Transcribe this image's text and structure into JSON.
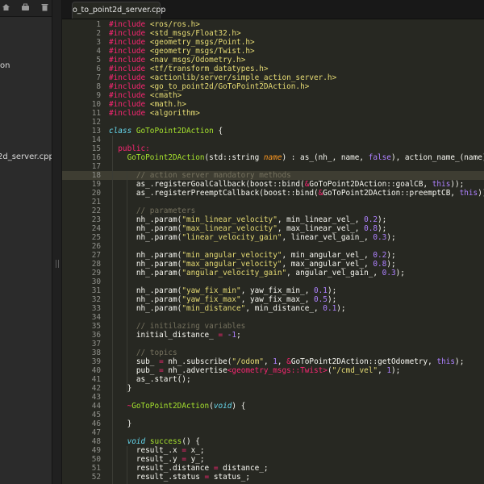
{
  "sidebar": {
    "items": [
      {
        "label": "on"
      },
      {
        "label": "2d_server.cpp"
      }
    ]
  },
  "editor": {
    "tab_title": "o_to_point2d_server.cpp",
    "lines": [
      {
        "n": "1",
        "parts": [
          {
            "t": "#include ",
            "c": "k"
          },
          {
            "t": "<ros/ros.h>",
            "c": "s"
          }
        ]
      },
      {
        "n": "2",
        "parts": [
          {
            "t": "#include ",
            "c": "k"
          },
          {
            "t": "<std_msgs/Float32.h>",
            "c": "s"
          }
        ]
      },
      {
        "n": "3",
        "parts": [
          {
            "t": "#include ",
            "c": "k"
          },
          {
            "t": "<geometry_msgs/Point.h>",
            "c": "s"
          }
        ]
      },
      {
        "n": "4",
        "parts": [
          {
            "t": "#include ",
            "c": "k"
          },
          {
            "t": "<geometry_msgs/Twist.h>",
            "c": "s"
          }
        ]
      },
      {
        "n": "5",
        "parts": [
          {
            "t": "#include ",
            "c": "k"
          },
          {
            "t": "<nav_msgs/Odometry.h>",
            "c": "s"
          }
        ]
      },
      {
        "n": "6",
        "parts": [
          {
            "t": "#include ",
            "c": "k"
          },
          {
            "t": "<tf/transform_datatypes.h>",
            "c": "s"
          }
        ]
      },
      {
        "n": "7",
        "parts": [
          {
            "t": "#include ",
            "c": "k"
          },
          {
            "t": "<actionlib/server/simple_action_server.h>",
            "c": "s"
          }
        ]
      },
      {
        "n": "8",
        "parts": [
          {
            "t": "#include ",
            "c": "k"
          },
          {
            "t": "<go_to_point2d/GoToPoint2DAction.h>",
            "c": "s"
          }
        ]
      },
      {
        "n": "9",
        "parts": [
          {
            "t": "#include ",
            "c": "k"
          },
          {
            "t": "<cmath>",
            "c": "s"
          }
        ]
      },
      {
        "n": "10",
        "parts": [
          {
            "t": "#include ",
            "c": "k"
          },
          {
            "t": "<math.h>",
            "c": "s"
          }
        ]
      },
      {
        "n": "11",
        "parts": [
          {
            "t": "#include ",
            "c": "k"
          },
          {
            "t": "<algorithm>",
            "c": "s"
          }
        ]
      },
      {
        "n": "12",
        "parts": []
      },
      {
        "n": "13",
        "parts": [
          {
            "t": "class ",
            "c": "t"
          },
          {
            "t": "GoToPoint2DAction",
            "c": "f"
          },
          {
            "t": " {",
            "c": ""
          }
        ]
      },
      {
        "n": "14",
        "parts": []
      },
      {
        "n": "15",
        "parts": [
          {
            "t": "  public:",
            "c": "k"
          }
        ]
      },
      {
        "n": "16",
        "parts": [
          {
            "t": "    ",
            "c": ""
          },
          {
            "t": "GoToPoint2DAction",
            "c": "f"
          },
          {
            "t": "(std::string ",
            "c": ""
          },
          {
            "t": "name",
            "c": "o"
          },
          {
            "t": ") : as_(nh_, name, ",
            "c": ""
          },
          {
            "t": "false",
            "c": "n"
          },
          {
            "t": "), action_name_(name) {",
            "c": ""
          }
        ]
      },
      {
        "n": "17",
        "parts": []
      },
      {
        "n": "18",
        "parts": [
          {
            "t": "      // action server mandatory methods",
            "c": "c"
          }
        ],
        "cursor": true
      },
      {
        "n": "19",
        "parts": [
          {
            "t": "      as_.registerGoalCallback(boost::bind(",
            "c": ""
          },
          {
            "t": "&",
            "c": "k"
          },
          {
            "t": "GoToPoint2DAction::goalCB, ",
            "c": ""
          },
          {
            "t": "this",
            "c": "n"
          },
          {
            "t": "));",
            "c": ""
          }
        ]
      },
      {
        "n": "20",
        "parts": [
          {
            "t": "      as_.registerPreemptCallback(boost::bind(",
            "c": ""
          },
          {
            "t": "&",
            "c": "k"
          },
          {
            "t": "GoToPoint2DAction::preemptCB, ",
            "c": ""
          },
          {
            "t": "this",
            "c": "n"
          },
          {
            "t": "));",
            "c": ""
          }
        ]
      },
      {
        "n": "21",
        "parts": []
      },
      {
        "n": "22",
        "parts": [
          {
            "t": "      // parameters",
            "c": "c"
          }
        ]
      },
      {
        "n": "23",
        "parts": [
          {
            "t": "      nh_.param(",
            "c": ""
          },
          {
            "t": "\"min_linear_velocity\"",
            "c": "s"
          },
          {
            "t": ", min_linear_vel_, ",
            "c": ""
          },
          {
            "t": "0.2",
            "c": "n"
          },
          {
            "t": ");",
            "c": ""
          }
        ]
      },
      {
        "n": "24",
        "parts": [
          {
            "t": "      nh_.param(",
            "c": ""
          },
          {
            "t": "\"max_linear_velocity\"",
            "c": "s"
          },
          {
            "t": ", max_linear_vel_, ",
            "c": ""
          },
          {
            "t": "0.8",
            "c": "n"
          },
          {
            "t": ");",
            "c": ""
          }
        ]
      },
      {
        "n": "25",
        "parts": [
          {
            "t": "      nh_.param(",
            "c": ""
          },
          {
            "t": "\"linear_velocity_gain\"",
            "c": "s"
          },
          {
            "t": ", linear_vel_gain_, ",
            "c": ""
          },
          {
            "t": "0.3",
            "c": "n"
          },
          {
            "t": ");",
            "c": ""
          }
        ]
      },
      {
        "n": "26",
        "parts": []
      },
      {
        "n": "27",
        "parts": [
          {
            "t": "      nh_.param(",
            "c": ""
          },
          {
            "t": "\"min_angular_velocity\"",
            "c": "s"
          },
          {
            "t": ", min_angular_vel_, ",
            "c": ""
          },
          {
            "t": "0.2",
            "c": "n"
          },
          {
            "t": ");",
            "c": ""
          }
        ]
      },
      {
        "n": "28",
        "parts": [
          {
            "t": "      nh_.param(",
            "c": ""
          },
          {
            "t": "\"max_angular_velocity\"",
            "c": "s"
          },
          {
            "t": ", max_angular_vel_, ",
            "c": ""
          },
          {
            "t": "0.8",
            "c": "n"
          },
          {
            "t": ");",
            "c": ""
          }
        ]
      },
      {
        "n": "29",
        "parts": [
          {
            "t": "      nh_.param(",
            "c": ""
          },
          {
            "t": "\"angular_velocity_gain\"",
            "c": "s"
          },
          {
            "t": ", angular_vel_gain_, ",
            "c": ""
          },
          {
            "t": "0.3",
            "c": "n"
          },
          {
            "t": ");",
            "c": ""
          }
        ]
      },
      {
        "n": "30",
        "parts": []
      },
      {
        "n": "31",
        "parts": [
          {
            "t": "      nh_.param(",
            "c": ""
          },
          {
            "t": "\"yaw_fix_min\"",
            "c": "s"
          },
          {
            "t": ", yaw_fix_min_, ",
            "c": ""
          },
          {
            "t": "0.1",
            "c": "n"
          },
          {
            "t": ");",
            "c": ""
          }
        ]
      },
      {
        "n": "32",
        "parts": [
          {
            "t": "      nh_.param(",
            "c": ""
          },
          {
            "t": "\"yaw_fix_max\"",
            "c": "s"
          },
          {
            "t": ", yaw_fix_max_, ",
            "c": ""
          },
          {
            "t": "0.5",
            "c": "n"
          },
          {
            "t": ");",
            "c": ""
          }
        ]
      },
      {
        "n": "33",
        "parts": [
          {
            "t": "      nh_.param(",
            "c": ""
          },
          {
            "t": "\"min_distance\"",
            "c": "s"
          },
          {
            "t": ", min_distance_, ",
            "c": ""
          },
          {
            "t": "0.1",
            "c": "n"
          },
          {
            "t": ");",
            "c": ""
          }
        ]
      },
      {
        "n": "34",
        "parts": []
      },
      {
        "n": "35",
        "parts": [
          {
            "t": "      // initilazing variables",
            "c": "c"
          }
        ]
      },
      {
        "n": "36",
        "parts": [
          {
            "t": "      initial_distance_ ",
            "c": ""
          },
          {
            "t": "=",
            "c": "k"
          },
          {
            "t": " ",
            "c": ""
          },
          {
            "t": "-1",
            "c": "n"
          },
          {
            "t": ";",
            "c": ""
          }
        ]
      },
      {
        "n": "37",
        "parts": []
      },
      {
        "n": "38",
        "parts": [
          {
            "t": "      // topics",
            "c": "c"
          }
        ]
      },
      {
        "n": "39",
        "parts": [
          {
            "t": "      sub_ ",
            "c": ""
          },
          {
            "t": "=",
            "c": "k"
          },
          {
            "t": " nh_.subscribe(",
            "c": ""
          },
          {
            "t": "\"/odom\"",
            "c": "s"
          },
          {
            "t": ", ",
            "c": ""
          },
          {
            "t": "1",
            "c": "n"
          },
          {
            "t": ", ",
            "c": ""
          },
          {
            "t": "&",
            "c": "k"
          },
          {
            "t": "GoToPoint2DAction::getOdometry, ",
            "c": ""
          },
          {
            "t": "this",
            "c": "n"
          },
          {
            "t": ");",
            "c": ""
          }
        ]
      },
      {
        "n": "40",
        "parts": [
          {
            "t": "      pub_ ",
            "c": ""
          },
          {
            "t": "=",
            "c": "k"
          },
          {
            "t": " nh_.advertise",
            "c": ""
          },
          {
            "t": "<geometry_msgs::Twist>",
            "c": "k"
          },
          {
            "t": "(",
            "c": ""
          },
          {
            "t": "\"/cmd_vel\"",
            "c": "s"
          },
          {
            "t": ", ",
            "c": ""
          },
          {
            "t": "1",
            "c": "n"
          },
          {
            "t": ");",
            "c": ""
          }
        ]
      },
      {
        "n": "41",
        "parts": [
          {
            "t": "      as_.start();",
            "c": ""
          }
        ]
      },
      {
        "n": "42",
        "parts": [
          {
            "t": "    }",
            "c": ""
          }
        ]
      },
      {
        "n": "43",
        "parts": []
      },
      {
        "n": "44",
        "parts": [
          {
            "t": "    ~",
            "c": "k"
          },
          {
            "t": "GoToPoint2DAction",
            "c": "f"
          },
          {
            "t": "(",
            "c": ""
          },
          {
            "t": "void",
            "c": "t"
          },
          {
            "t": ") {",
            "c": ""
          }
        ]
      },
      {
        "n": "45",
        "parts": []
      },
      {
        "n": "46",
        "parts": [
          {
            "t": "    }",
            "c": ""
          }
        ]
      },
      {
        "n": "47",
        "parts": []
      },
      {
        "n": "48",
        "parts": [
          {
            "t": "    ",
            "c": ""
          },
          {
            "t": "void",
            "c": "t"
          },
          {
            "t": " ",
            "c": ""
          },
          {
            "t": "success",
            "c": "f"
          },
          {
            "t": "() {",
            "c": ""
          }
        ]
      },
      {
        "n": "49",
        "parts": [
          {
            "t": "      result_.x ",
            "c": ""
          },
          {
            "t": "=",
            "c": "k"
          },
          {
            "t": " x_;",
            "c": ""
          }
        ]
      },
      {
        "n": "50",
        "parts": [
          {
            "t": "      result_.y ",
            "c": ""
          },
          {
            "t": "=",
            "c": "k"
          },
          {
            "t": " y_;",
            "c": ""
          }
        ]
      },
      {
        "n": "51",
        "parts": [
          {
            "t": "      result_.distance ",
            "c": ""
          },
          {
            "t": "=",
            "c": "k"
          },
          {
            "t": " distance_;",
            "c": ""
          }
        ]
      },
      {
        "n": "52",
        "parts": [
          {
            "t": "      result_.status ",
            "c": ""
          },
          {
            "t": "=",
            "c": "k"
          },
          {
            "t": " status_;",
            "c": ""
          }
        ]
      }
    ]
  }
}
